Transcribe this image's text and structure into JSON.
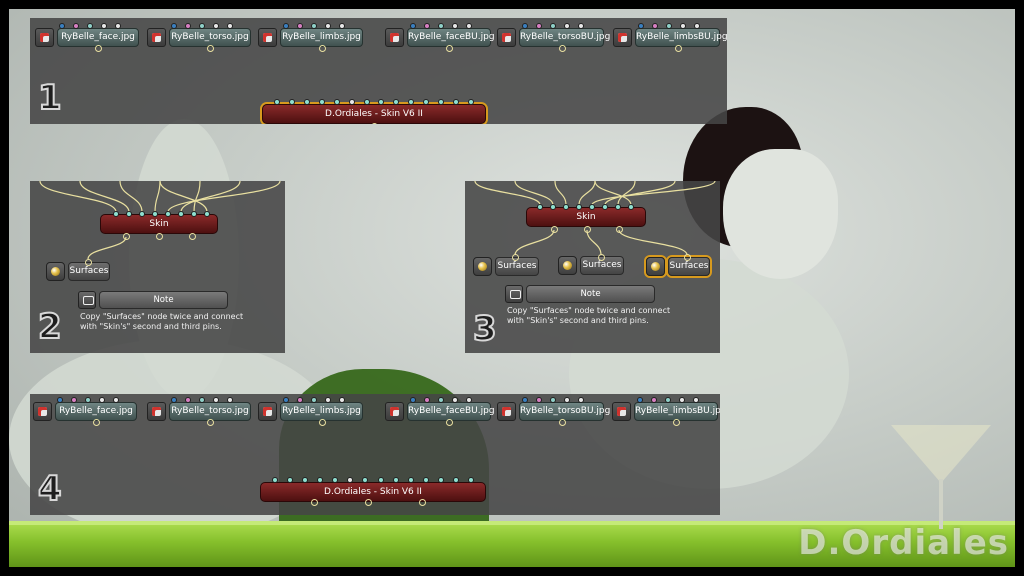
{
  "watermark": "D.Ordiales",
  "colors": {
    "texture_pin_a": "#3a7fbf",
    "texture_pin_b": "#d77fc2",
    "texture_pin_c": "#8fd0c8",
    "texture_pin_d": "#e8e8e8",
    "shader_pin": "#8fe0d0",
    "wire": "#e9e0a0",
    "selection": "#d79a1e"
  },
  "textures": {
    "face": "RyBelle_face.jpg",
    "torso": "RyBelle_torso.jpg",
    "limbs": "RyBelle_limbs.jpg",
    "face_bu": "RyBelle_faceBU.jpg",
    "torso_bu": "RyBelle_torsoBU.jpg",
    "limbs_bu": "RyBelle_limbsBU.jpg"
  },
  "panel1": {
    "step": "1",
    "shader": "D.Ordiales - Skin V6 II"
  },
  "panel2": {
    "step": "2",
    "skin": "Skin",
    "surfaces": "Surfaces",
    "note_title": "Note",
    "note_text": "Copy \"Surfaces\" node twice and connect\nwith \"Skin's\" second and third pins."
  },
  "panel3": {
    "step": "3",
    "skin": "Skin",
    "surfaces": [
      "Surfaces",
      "Surfaces",
      "Surfaces"
    ],
    "note_title": "Note",
    "note_text": "Copy \"Surfaces\" node twice and connect\nwith \"Skin's\" second and third pins."
  },
  "panel4": {
    "step": "4",
    "shader": "D.Ordiales - Skin V6 II"
  }
}
